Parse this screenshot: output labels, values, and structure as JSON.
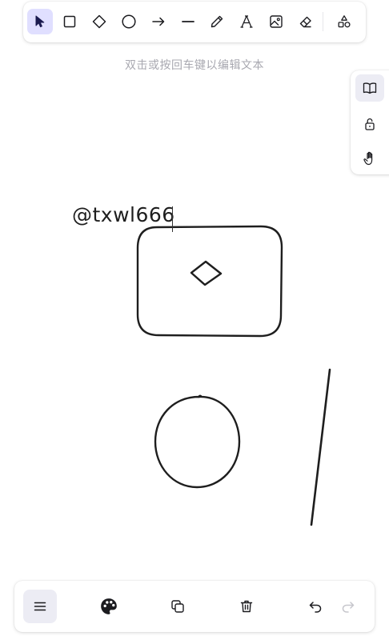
{
  "toolbar": {
    "tools": [
      {
        "name": "select",
        "icon": "pointer-icon",
        "active": true
      },
      {
        "name": "rectangle",
        "icon": "rectangle-icon",
        "active": false
      },
      {
        "name": "diamond",
        "icon": "diamond-icon",
        "active": false
      },
      {
        "name": "ellipse",
        "icon": "ellipse-icon",
        "active": false
      },
      {
        "name": "arrow",
        "icon": "arrow-icon",
        "active": false
      },
      {
        "name": "line",
        "icon": "line-icon",
        "active": false
      },
      {
        "name": "draw",
        "icon": "pencil-icon",
        "active": false
      },
      {
        "name": "text",
        "icon": "text-icon",
        "active": false
      },
      {
        "name": "image",
        "icon": "image-icon",
        "active": false
      },
      {
        "name": "eraser",
        "icon": "eraser-icon",
        "active": false
      },
      {
        "name": "more-shapes",
        "icon": "shapes-icon",
        "active": false
      }
    ]
  },
  "hint": {
    "text": "双击或按回车键以编辑文本"
  },
  "side_panel": {
    "items": [
      {
        "name": "library",
        "icon": "book-icon",
        "active": true
      },
      {
        "name": "lock",
        "icon": "unlock-icon",
        "active": false
      },
      {
        "name": "hand",
        "icon": "hand-icon",
        "active": false
      }
    ]
  },
  "canvas": {
    "text_element": "@txwl666"
  },
  "bottom_toolbar": {
    "items": [
      {
        "name": "menu",
        "icon": "hamburger-icon"
      },
      {
        "name": "style",
        "icon": "palette-icon"
      },
      {
        "name": "duplicate",
        "icon": "duplicate-icon"
      },
      {
        "name": "delete",
        "icon": "trash-icon"
      },
      {
        "name": "undo",
        "icon": "undo-icon",
        "enabled": true
      },
      {
        "name": "redo",
        "icon": "redo-icon",
        "enabled": false
      }
    ]
  },
  "colors": {
    "accent": "#e0dfff",
    "icon": "#1b1b1f",
    "stroke": "#1e1e1e",
    "hint": "#a8a8b0"
  }
}
